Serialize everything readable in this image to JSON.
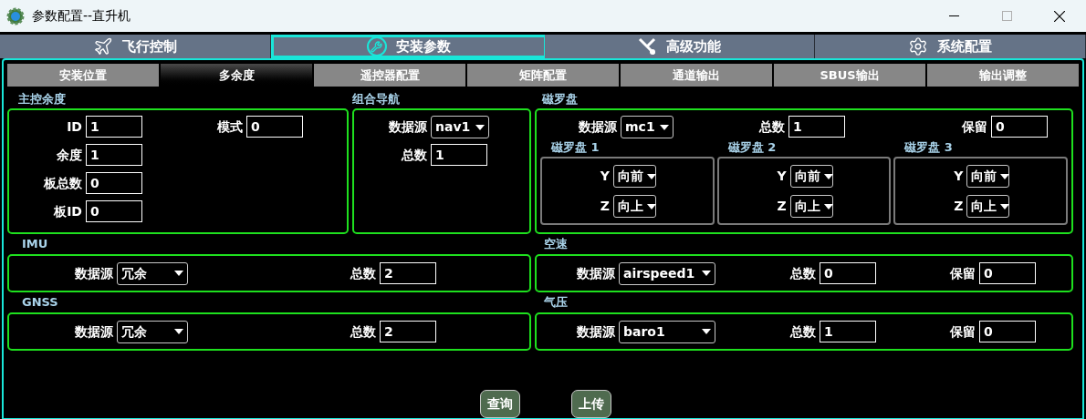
{
  "window": {
    "title": "参数配置--直升机"
  },
  "main_tabs": [
    {
      "label": "飞行控制",
      "selected": false
    },
    {
      "label": "安装参数",
      "selected": true
    },
    {
      "label": "高级功能",
      "selected": false
    },
    {
      "label": "系统配置",
      "selected": false
    }
  ],
  "sub_tabs": [
    {
      "label": "安装位置",
      "selected": false
    },
    {
      "label": "多余度",
      "selected": true
    },
    {
      "label": "遥控器配置",
      "selected": false
    },
    {
      "label": "矩阵配置",
      "selected": false
    },
    {
      "label": "通道输出",
      "selected": false
    },
    {
      "label": "SBUS输出",
      "selected": false
    },
    {
      "label": "输出调整",
      "selected": false
    }
  ],
  "master_redundancy": {
    "title": "主控余度",
    "fields": [
      {
        "label": "ID",
        "value": "1"
      },
      {
        "label": "余度",
        "value": "1"
      },
      {
        "label": "板总数",
        "value": "0"
      },
      {
        "label": "板ID",
        "value": "0"
      }
    ],
    "mode": {
      "label": "模式",
      "value": "0"
    }
  },
  "integrated_nav": {
    "title": "组合导航",
    "source": {
      "label": "数据源",
      "value": "nav1"
    },
    "total": {
      "label": "总数",
      "value": "1"
    }
  },
  "compass": {
    "title": "磁罗盘",
    "source": {
      "label": "数据源",
      "value": "mc1"
    },
    "total": {
      "label": "总数",
      "value": "1"
    },
    "reserved": {
      "label": "保留",
      "value": "0"
    },
    "units": [
      {
        "title": "磁罗盘 1",
        "y": {
          "label": "Y",
          "value": "向前"
        },
        "z": {
          "label": "Z",
          "value": "向上"
        }
      },
      {
        "title": "磁罗盘 2",
        "y": {
          "label": "Y",
          "value": "向前"
        },
        "z": {
          "label": "Z",
          "value": "向上"
        }
      },
      {
        "title": "磁罗盘 3",
        "y": {
          "label": "Y",
          "value": "向前"
        },
        "z": {
          "label": "Z",
          "value": "向上"
        }
      }
    ]
  },
  "imu": {
    "title": "IMU",
    "source": {
      "label": "数据源",
      "value": "冗余"
    },
    "total": {
      "label": "总数",
      "value": "2"
    }
  },
  "airspeed": {
    "title": "空速",
    "source": {
      "label": "数据源",
      "value": "airspeed1"
    },
    "total": {
      "label": "总数",
      "value": "0"
    },
    "reserved": {
      "label": "保留",
      "value": "0"
    }
  },
  "gnss": {
    "title": "GNSS",
    "source": {
      "label": "数据源",
      "value": "冗余"
    },
    "total": {
      "label": "总数",
      "value": "2"
    }
  },
  "baro": {
    "title": "气压",
    "source": {
      "label": "数据源",
      "value": "baro1"
    },
    "total": {
      "label": "总数",
      "value": "1"
    },
    "reserved": {
      "label": "保留",
      "value": "0"
    }
  },
  "buttons": [
    "查询",
    "上传"
  ]
}
